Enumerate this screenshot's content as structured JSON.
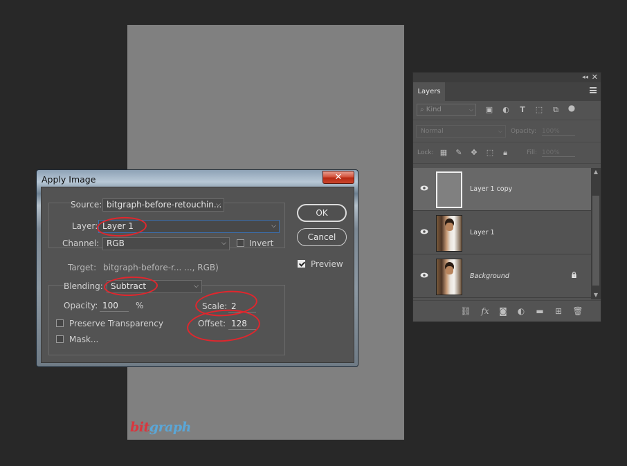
{
  "document": {
    "logo": {
      "part1": "bit",
      "part2": "graph"
    }
  },
  "layers_panel": {
    "collapse_glyph": "◂◂",
    "close_glyph": "✕",
    "tab_label": "Layers",
    "filter": {
      "placeholder": "Kind",
      "icons": [
        "image-filter-icon",
        "adjustment-filter-icon",
        "type-filter-icon",
        "shape-filter-icon",
        "smart-object-filter-icon"
      ]
    },
    "blend_mode": "Normal",
    "opacity_label": "Opacity:",
    "opacity_value": "100%",
    "lock_label": "Lock:",
    "fill_label": "Fill:",
    "fill_value": "100%",
    "layers": [
      {
        "name": "Layer 1 copy",
        "selected": true
      },
      {
        "name": "Layer 1",
        "selected": false
      },
      {
        "name": "Background",
        "selected": false,
        "locked": true
      }
    ],
    "footer_icons": [
      "link-layers-icon",
      "fx-icon",
      "add-mask-icon",
      "adjustment-layer-icon",
      "group-folder-icon",
      "new-layer-icon",
      "trash-icon"
    ]
  },
  "dialog": {
    "title": "Apply Image",
    "close_glyph": "✕",
    "source_label": "Source:",
    "source_value": "bitgraph-before-retouchin...",
    "layer_label": "Layer:",
    "layer_value": "Layer 1",
    "channel_label": "Channel:",
    "channel_value": "RGB",
    "invert_label": "Invert",
    "target_label": "Target:",
    "target_value": "bitgraph-before-r... ..., RGB)",
    "blending_label": "Blending:",
    "blending_value": "Subtract",
    "opacity_label": "Opacity:",
    "opacity_value": "100",
    "opacity_unit": "%",
    "scale_label": "Scale:",
    "scale_value": "2",
    "offset_label": "Offset:",
    "offset_value": "128",
    "preserve_label": "Preserve Transparency",
    "mask_label": "Mask...",
    "ok_label": "OK",
    "cancel_label": "Cancel",
    "preview_label": "Preview",
    "preview_checked": true,
    "invert_checked": false,
    "preserve_checked": false,
    "mask_checked": false
  },
  "colors": {
    "annotation_red": "#e1262d",
    "canvas_gray": "#808080",
    "panel_bg": "#535353",
    "workspace_bg": "#282828"
  }
}
